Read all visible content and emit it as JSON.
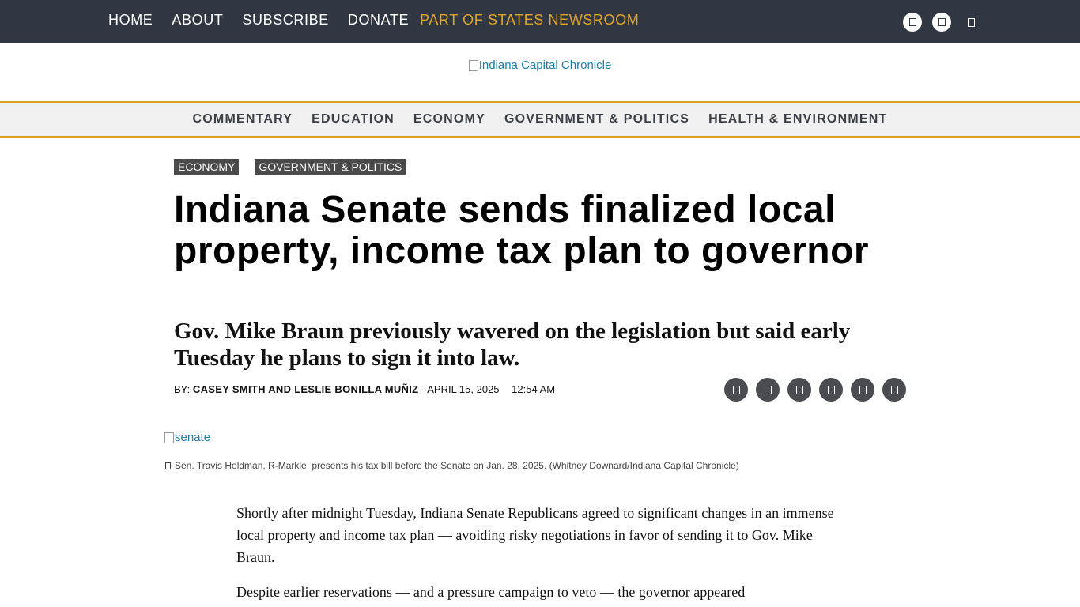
{
  "topbar": {
    "nav": [
      "HOME",
      "ABOUT",
      "SUBSCRIBE",
      "DONATE"
    ],
    "part_of": "PART OF STATES NEWSROOM",
    "social_icons": [
      "facebook-icon",
      "twitter-icon",
      "instagram-icon"
    ]
  },
  "logo": {
    "alt": "Indiana Capital Chronicle"
  },
  "sections": [
    "COMMENTARY",
    "EDUCATION",
    "ECONOMY",
    "GOVERNMENT & POLITICS",
    "HEALTH & ENVIRONMENT"
  ],
  "article": {
    "tags": [
      "ECONOMY",
      "GOVERNMENT & POLITICS"
    ],
    "headline": "Indiana Senate sends finalized local property, income tax plan to governor",
    "subhead": "Gov. Mike Braun previously wavered on the legislation but said early Tuesday he plans to sign it into law.",
    "byline_prefix": "BY:",
    "authors": "CASEY SMITH AND LESLIE BONILLA MUÑIZ",
    "date": "- APRIL 15, 2025",
    "time": "12:54 AM",
    "share_icons": [
      "email-icon",
      "facebook-icon",
      "twitter-icon",
      "linkedin-icon",
      "print-icon",
      "republish-icon"
    ],
    "image_alt": "senate",
    "caption": "Sen. Travis Holdman, R-Markle, presents his tax bill before the Senate on Jan. 28, 2025. (Whitney Downard/Indiana Capital Chronicle)",
    "paragraphs": [
      "Shortly after midnight Tuesday, Indiana Senate Republicans agreed to significant changes in an immense local property and income tax plan — avoiding risky negotiations in favor of sending it to Gov. Mike Braun.",
      "Despite earlier reservations — and a pressure campaign to veto — the governor appeared"
    ]
  },
  "colors": {
    "topbar_bg": "#313742",
    "accent_gold": "#e0a526",
    "link_blue": "#1e7bb0",
    "tag_bg": "#4a4a4a",
    "section_nav_bg": "#f0f0f0"
  }
}
